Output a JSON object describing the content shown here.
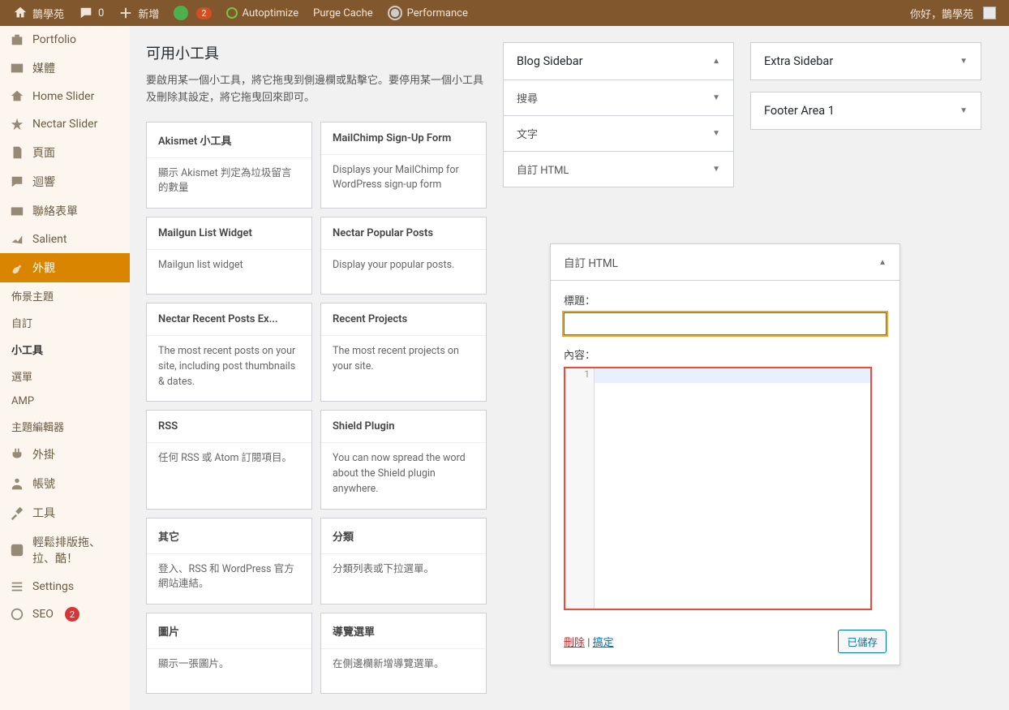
{
  "adminbar": {
    "site_name": "鵲學苑",
    "comments_count": "0",
    "new_label": "新增",
    "updates_count": "2",
    "autoptimize": "Autoptimize",
    "purge_cache": "Purge Cache",
    "performance": "Performance",
    "greeting": "你好，鵲學苑"
  },
  "sidebar": {
    "items": [
      {
        "label": "Portfolio",
        "icon": "portfolio"
      },
      {
        "label": "媒體",
        "icon": "media"
      },
      {
        "label": "Home Slider",
        "icon": "home"
      },
      {
        "label": "Nectar Slider",
        "icon": "star"
      },
      {
        "label": "頁面",
        "icon": "page"
      },
      {
        "label": "迴響",
        "icon": "comment"
      },
      {
        "label": "聯絡表單",
        "icon": "mail"
      },
      {
        "label": "Salient",
        "icon": "salient"
      },
      {
        "label": "外觀",
        "icon": "appearance",
        "active": true
      },
      {
        "label": "外掛",
        "icon": "plugin"
      },
      {
        "label": "帳號",
        "icon": "user"
      },
      {
        "label": "工具",
        "icon": "tools"
      },
      {
        "label": "輕鬆排版拖、拉、酷！",
        "icon": "drag"
      },
      {
        "label": "Settings",
        "icon": "settings"
      },
      {
        "label": "SEO",
        "icon": "seo",
        "badge": "2"
      }
    ],
    "sub": [
      {
        "label": "佈景主題"
      },
      {
        "label": "自訂"
      },
      {
        "label": "小工具",
        "current": true
      },
      {
        "label": "選單"
      },
      {
        "label": "AMP"
      },
      {
        "label": "主題編輯器"
      }
    ]
  },
  "main": {
    "title": "可用小工具",
    "help": "要啟用某一個小工具，將它拖曳到側邊欄或點擊它。要停用某一個小工具及刪除其設定，將它拖曳回來即可。",
    "widgets": [
      {
        "title": "Akismet 小工具",
        "desc": "顯示 Akismet 判定為垃圾留言的數量"
      },
      {
        "title": "MailChimp Sign-Up Form",
        "desc": "Displays your MailChimp for WordPress sign-up form"
      },
      {
        "title": "Mailgun List Widget",
        "desc": "Mailgun list widget"
      },
      {
        "title": "Nectar Popular Posts",
        "desc": "Display your popular posts."
      },
      {
        "title": "Nectar Recent Posts Ex...",
        "desc": "The most recent posts on your site, including post thumbnails & dates."
      },
      {
        "title": "Recent Projects",
        "desc": "The most recent projects on your site."
      },
      {
        "title": "RSS",
        "desc": "任何 RSS 或 Atom 訂閱項目。"
      },
      {
        "title": "Shield Plugin",
        "desc": "You can now spread the word about the Shield plugin anywhere."
      },
      {
        "title": "其它",
        "desc": "登入、RSS 和 WordPress 官方網站連結。"
      },
      {
        "title": "分類",
        "desc": "分類列表或下拉選單。"
      },
      {
        "title": "圖片",
        "desc": "顯示一張圖片。"
      },
      {
        "title": "導覽選單",
        "desc": "在側邊欄新增導覽選單。"
      }
    ]
  },
  "areas": {
    "blog_sidebar": {
      "title": "Blog Sidebar",
      "items": [
        {
          "label": "搜尋"
        },
        {
          "label": "文字"
        },
        {
          "label": "自訂 HTML"
        }
      ]
    },
    "extra_sidebar": {
      "title": "Extra Sidebar"
    },
    "footer1": {
      "title": "Footer Area 1"
    }
  },
  "editor": {
    "head": "自訂 HTML",
    "title_label": "標題：",
    "title_value": "",
    "content_label": "內容：",
    "line_number": "1",
    "delete": "刪除",
    "sep": " | ",
    "done": "搞定",
    "saved": "已儲存"
  }
}
